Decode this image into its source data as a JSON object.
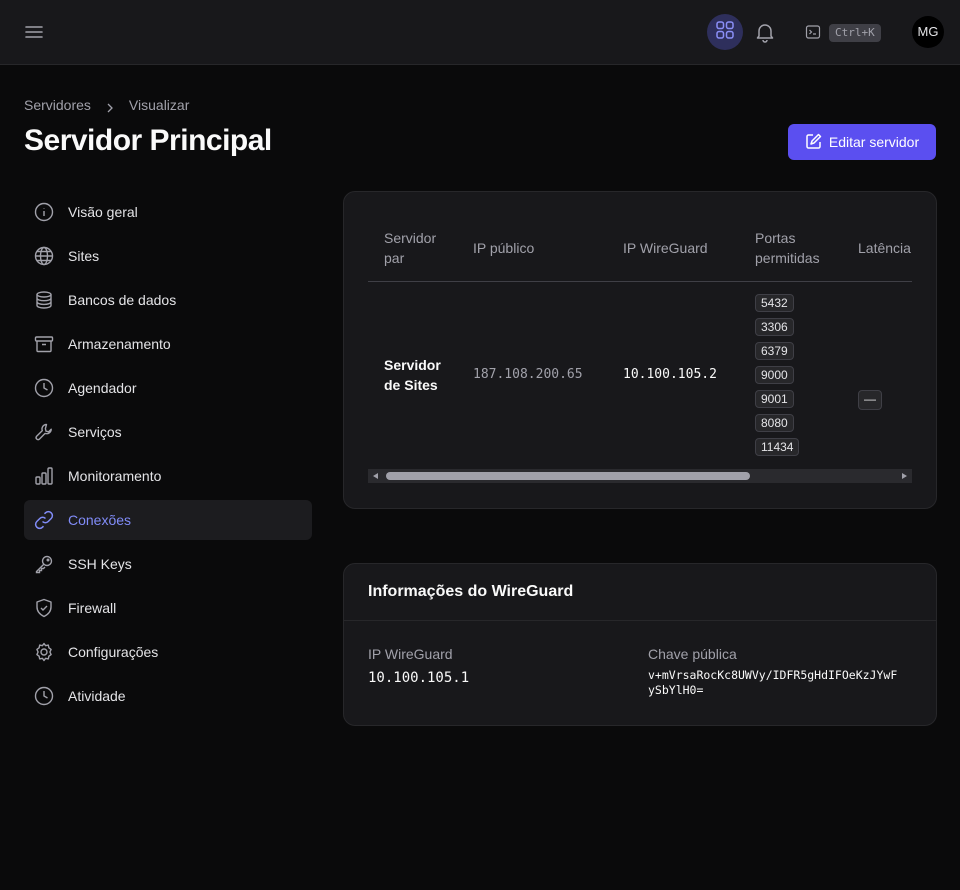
{
  "topbar": {
    "menu_icon": "hamburger-icon",
    "apps_icon": "grid-icon",
    "bell_icon": "bell-icon",
    "terminal_icon": "terminal-icon",
    "shortcut": "Ctrl+K",
    "avatar_initials": "MG"
  },
  "breadcrumb": {
    "items": [
      "Servidores",
      "Visualizar"
    ]
  },
  "page": {
    "title": "Servidor Principal",
    "edit_button": "Editar servidor"
  },
  "colors": {
    "accent": "#5b4ff0",
    "active_nav": "#818cf8",
    "background": "#0a0a0b",
    "card": "#18181b"
  },
  "sidebar": {
    "items": [
      {
        "label": "Visão geral",
        "icon": "info-icon"
      },
      {
        "label": "Sites",
        "icon": "globe-icon"
      },
      {
        "label": "Bancos de dados",
        "icon": "database-icon"
      },
      {
        "label": "Armazenamento",
        "icon": "archive-icon"
      },
      {
        "label": "Agendador",
        "icon": "clock-icon"
      },
      {
        "label": "Serviços",
        "icon": "wrench-icon"
      },
      {
        "label": "Monitoramento",
        "icon": "bar-chart-icon"
      },
      {
        "label": "Conexões",
        "icon": "link-icon",
        "active": true
      },
      {
        "label": "SSH Keys",
        "icon": "key-icon"
      },
      {
        "label": "Firewall",
        "icon": "shield-icon"
      },
      {
        "label": "Configurações",
        "icon": "gear-icon"
      },
      {
        "label": "Atividade",
        "icon": "clock-icon"
      }
    ]
  },
  "peers_table": {
    "columns": [
      "Servidor par",
      "IP público",
      "IP WireGuard",
      "Portas permitidas",
      "Latência"
    ],
    "rows": [
      {
        "server": "Servidor de Sites",
        "public_ip": "187.108.200.65",
        "wireguard_ip": "10.100.105.2",
        "ports": [
          "5432",
          "3306",
          "6379",
          "9000",
          "9001",
          "8080",
          "11434"
        ],
        "latency": "—"
      }
    ]
  },
  "wireguard": {
    "title": "Informações do WireGuard",
    "ip_label": "IP WireGuard",
    "ip_value": "10.100.105.1",
    "key_label": "Chave pública",
    "key_line1": "v+mVrsaRocKc8UWVy/IDFR5gHdIFOeKzJYwF",
    "key_line2": "ySbYlH0="
  }
}
